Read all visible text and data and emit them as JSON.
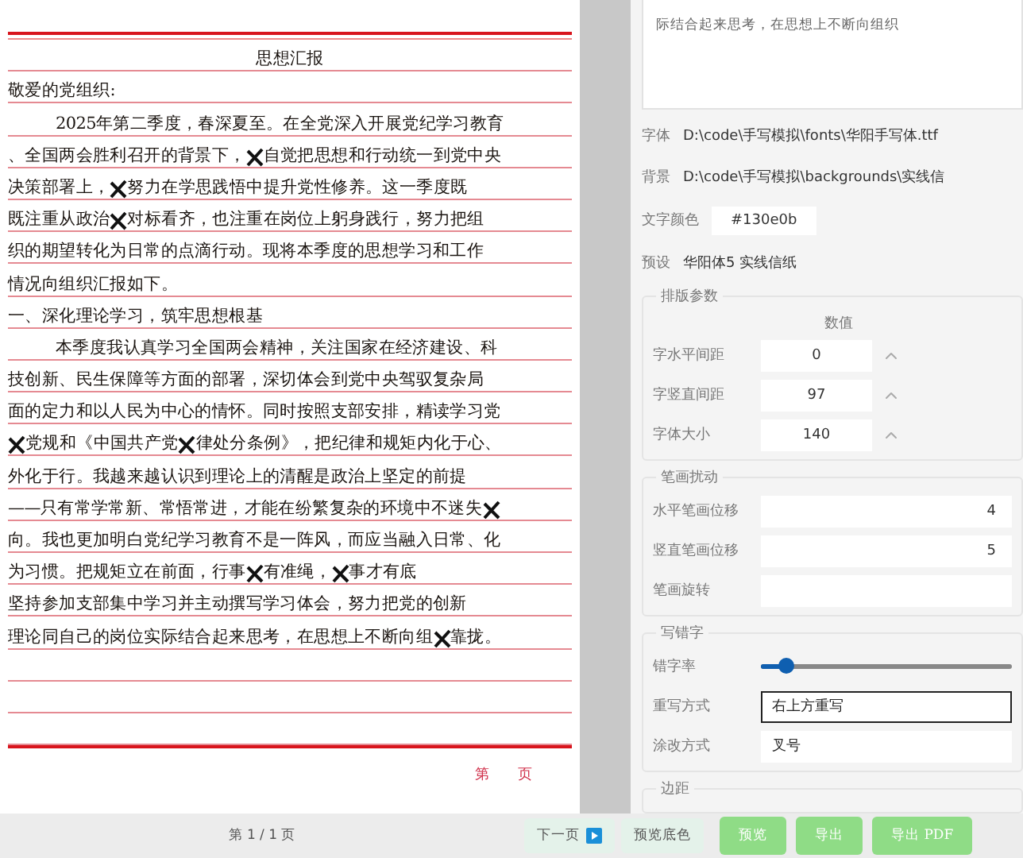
{
  "document": {
    "title": "思想汇报",
    "lines": [
      {
        "kind": "plain",
        "segments": [
          {
            "kind": "text",
            "text": "敬爱的党组织:"
          }
        ]
      },
      {
        "kind": "indent",
        "segments": [
          {
            "kind": "text",
            "text": "2025年第二季度，春深夏至。在全党深入开展党纪学习教育"
          }
        ]
      },
      {
        "kind": "plain",
        "segments": [
          {
            "kind": "text",
            "text": "、全国两会胜利召开的背景下，"
          },
          {
            "kind": "strike"
          },
          {
            "kind": "text",
            "text": "自觉把思想和行动统一到党中央"
          }
        ]
      },
      {
        "kind": "plain",
        "segments": [
          {
            "kind": "text",
            "text": "决策部署上，"
          },
          {
            "kind": "strike"
          },
          {
            "kind": "text",
            "text": "努力在学思践悟中提升党性修养。这一季度既"
          }
        ]
      },
      {
        "kind": "plain",
        "segments": [
          {
            "kind": "text",
            "text": "既注重从政治"
          },
          {
            "kind": "strike"
          },
          {
            "kind": "text",
            "text": "对标看齐，也注重在岗位上躬身践行，努力把组"
          }
        ]
      },
      {
        "kind": "plain",
        "segments": [
          {
            "kind": "text",
            "text": "织的期望转化为日常的点滴行动。现将本季度的思想学习和工作"
          }
        ]
      },
      {
        "kind": "plain",
        "segments": [
          {
            "kind": "text",
            "text": "情况向组织汇报如下。"
          }
        ]
      },
      {
        "kind": "plain",
        "segments": [
          {
            "kind": "text",
            "text": "一、深化理论学习，筑牢思想根基"
          }
        ]
      },
      {
        "kind": "indent",
        "segments": [
          {
            "kind": "text",
            "text": "本季度我认真学习全国两会精神，关注国家在经济建设、科"
          }
        ]
      },
      {
        "kind": "plain",
        "segments": [
          {
            "kind": "text",
            "text": "技创新、民生保障等方面的部署，深切体会到党中央驾驭复杂局"
          }
        ]
      },
      {
        "kind": "plain",
        "segments": [
          {
            "kind": "text",
            "text": "面的定力和以人民为中心的情怀。同时按照支部安排，精读学习党"
          }
        ]
      },
      {
        "kind": "plain",
        "segments": [
          {
            "kind": "strike"
          },
          {
            "kind": "text",
            "text": "党规和《中国共产党"
          },
          {
            "kind": "strike"
          },
          {
            "kind": "text",
            "text": "律处分条例》，把纪律和规矩内化于心、"
          }
        ]
      },
      {
        "kind": "plain",
        "segments": [
          {
            "kind": "text",
            "text": "外化于行。我越来越认识到理论上的清醒是政治上坚定的前提"
          }
        ]
      },
      {
        "kind": "plain",
        "segments": [
          {
            "kind": "text",
            "text": "——只有常学常新、常悟常进，才能在纷繁复杂的环境中不迷失"
          },
          {
            "kind": "strike"
          }
        ]
      },
      {
        "kind": "plain",
        "segments": [
          {
            "kind": "text",
            "text": "向。我也更加明白党纪学习教育不是一阵风，而应当融入日常、化"
          }
        ]
      },
      {
        "kind": "plain",
        "segments": [
          {
            "kind": "text",
            "text": "为习惯。把规矩立在前面，行事"
          },
          {
            "kind": "strike"
          },
          {
            "kind": "text",
            "text": "有准绳，"
          },
          {
            "kind": "strike"
          },
          {
            "kind": "text",
            "text": "事才有底"
          }
        ]
      },
      {
        "kind": "plain",
        "segments": [
          {
            "kind": "text",
            "text": "坚持参加支部集中学习并主动撰写学习体会，努力把党的创新"
          }
        ]
      },
      {
        "kind": "plain",
        "segments": [
          {
            "kind": "text",
            "text": "理论同自己的岗位实际结合起来思考，在思想上不断向组"
          },
          {
            "kind": "strike"
          },
          {
            "kind": "text",
            "text": "靠拢。"
          }
        ]
      }
    ],
    "footer": "第　　页"
  },
  "pagination": "第 1 / 1 页",
  "left_buttons": [
    {
      "kind": "next",
      "label": "下一页"
    },
    {
      "kind": "plain",
      "label": "预览底色"
    }
  ],
  "editor": {
    "text": "际结合起来思考，在思想上不断向组织"
  },
  "fields": [
    {
      "kind": "path",
      "label": "字体",
      "value": "D:\\code\\手写模拟\\fonts\\华阳手写体.ttf"
    },
    {
      "kind": "path",
      "label": "背景",
      "value": "D:\\code\\手写模拟\\backgrounds\\实线信"
    },
    {
      "kind": "color",
      "label": "文字颜色",
      "value": "#130e0b"
    },
    {
      "kind": "path",
      "label": "预设",
      "value": "华阳体5 实线信纸"
    }
  ],
  "groups": [
    {
      "kind": "spin",
      "title": "排版参数",
      "header": "数值",
      "rows": [
        {
          "label": "字水平间距",
          "value": "0"
        },
        {
          "label": "字竖直间距",
          "value": "97"
        },
        {
          "label": "字体大小",
          "value": "140"
        }
      ]
    },
    {
      "kind": "offset",
      "title": "笔画扰动",
      "rows": [
        {
          "label": "水平笔画位移",
          "value": "4"
        },
        {
          "label": "竖直笔画位移",
          "value": "5"
        },
        {
          "label": "笔画旋转"
        }
      ]
    },
    {
      "kind": "mixed",
      "title": "写错字",
      "rows": [
        {
          "kind": "slider",
          "label": "错字率",
          "level": 0.1
        },
        {
          "kind": "select",
          "label": "重写方式",
          "value": "右上方重写",
          "focused": true
        },
        {
          "kind": "select",
          "label": "涂改方式",
          "value": "叉号",
          "focused": false
        }
      ]
    },
    {
      "title": "边距"
    }
  ],
  "action_buttons": [
    "预览",
    "导出",
    "导出 PDF"
  ]
}
